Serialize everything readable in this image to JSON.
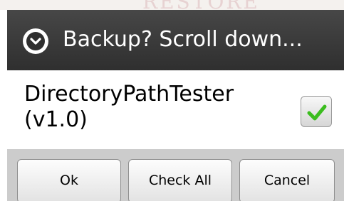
{
  "background": {
    "watermark_text": "RESTORE"
  },
  "dialog": {
    "title": "Backup? Scroll down...",
    "title_icon": "chevron-circle-down-icon",
    "item": {
      "name": "DirectoryPathTester",
      "version": "(v1.0)",
      "checked": true
    },
    "buttons": {
      "ok": "Ok",
      "check_all": "Check All",
      "cancel": "Cancel"
    }
  },
  "colors": {
    "title_bar": "#3a3a3a",
    "button_bar": "#cccccc",
    "check_green": "#3bbd1e"
  }
}
